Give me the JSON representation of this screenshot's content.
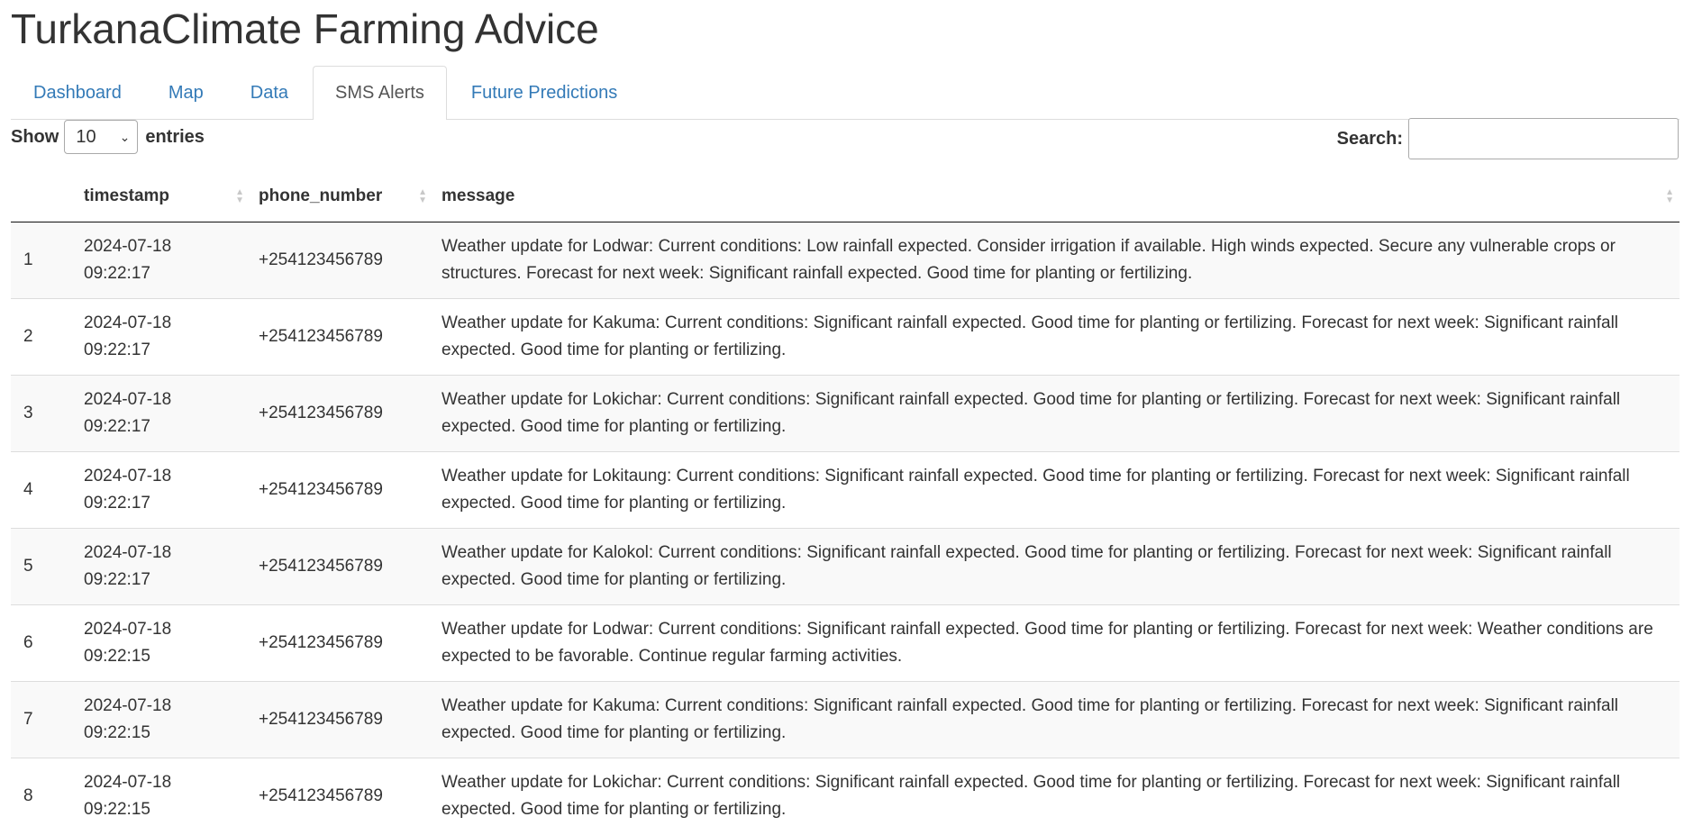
{
  "app": {
    "title": "TurkanaClimate Farming Advice"
  },
  "tabs": [
    {
      "label": "Dashboard",
      "active": false
    },
    {
      "label": "Map",
      "active": false
    },
    {
      "label": "Data",
      "active": false
    },
    {
      "label": "SMS Alerts",
      "active": true
    },
    {
      "label": "Future Predictions",
      "active": false
    }
  ],
  "length_control": {
    "show_label": "Show",
    "selected": "10",
    "entries_label": "entries"
  },
  "search": {
    "label": "Search:",
    "value": ""
  },
  "table": {
    "columns": [
      "",
      "timestamp",
      "phone_number",
      "message"
    ],
    "rows": [
      {
        "index": "1",
        "timestamp": "2024-07-18 09:22:17",
        "phone_number": "+254123456789",
        "message": "Weather update for Lodwar: Current conditions: Low rainfall expected. Consider irrigation if available. High winds expected. Secure any vulnerable crops or structures. Forecast for next week: Significant rainfall expected. Good time for planting or fertilizing."
      },
      {
        "index": "2",
        "timestamp": "2024-07-18 09:22:17",
        "phone_number": "+254123456789",
        "message": "Weather update for Kakuma: Current conditions: Significant rainfall expected. Good time for planting or fertilizing. Forecast for next week: Significant rainfall expected. Good time for planting or fertilizing."
      },
      {
        "index": "3",
        "timestamp": "2024-07-18 09:22:17",
        "phone_number": "+254123456789",
        "message": "Weather update for Lokichar: Current conditions: Significant rainfall expected. Good time for planting or fertilizing. Forecast for next week: Significant rainfall expected. Good time for planting or fertilizing."
      },
      {
        "index": "4",
        "timestamp": "2024-07-18 09:22:17",
        "phone_number": "+254123456789",
        "message": "Weather update for Lokitaung: Current conditions: Significant rainfall expected. Good time for planting or fertilizing. Forecast for next week: Significant rainfall expected. Good time for planting or fertilizing."
      },
      {
        "index": "5",
        "timestamp": "2024-07-18 09:22:17",
        "phone_number": "+254123456789",
        "message": "Weather update for Kalokol: Current conditions: Significant rainfall expected. Good time for planting or fertilizing. Forecast for next week: Significant rainfall expected. Good time for planting or fertilizing."
      },
      {
        "index": "6",
        "timestamp": "2024-07-18 09:22:15",
        "phone_number": "+254123456789",
        "message": "Weather update for Lodwar: Current conditions: Significant rainfall expected. Good time for planting or fertilizing. Forecast for next week: Weather conditions are expected to be favorable. Continue regular farming activities."
      },
      {
        "index": "7",
        "timestamp": "2024-07-18 09:22:15",
        "phone_number": "+254123456789",
        "message": "Weather update for Kakuma: Current conditions: Significant rainfall expected. Good time for planting or fertilizing. Forecast for next week: Significant rainfall expected. Good time for planting or fertilizing."
      },
      {
        "index": "8",
        "timestamp": "2024-07-18 09:22:15",
        "phone_number": "+254123456789",
        "message": "Weather update for Lokichar: Current conditions: Significant rainfall expected. Good time for planting or fertilizing. Forecast for next week: Significant rainfall expected. Good time for planting or fertilizing."
      }
    ]
  }
}
